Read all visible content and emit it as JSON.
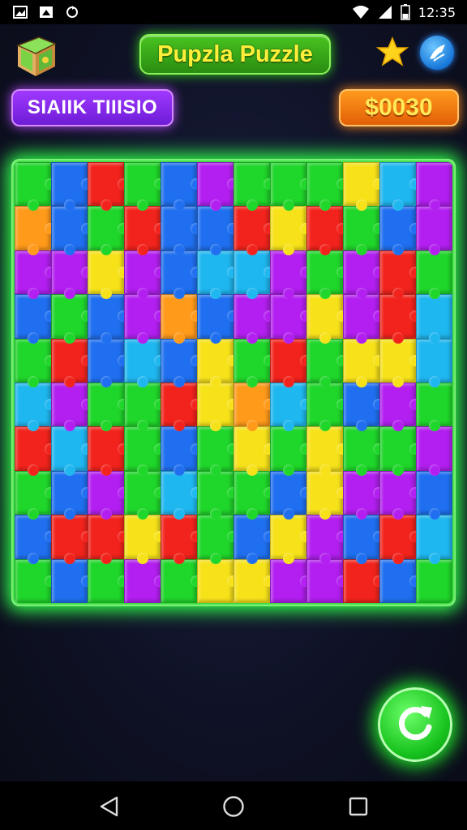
{
  "status_bar": {
    "time": "12:35"
  },
  "header": {
    "title": "Pupzla Puzzle",
    "level_label": "SIAIIK TIIISIO",
    "coins": "$0030"
  },
  "colors": {
    "board_glow": "#2fff4a",
    "title_green": "#2a8d12",
    "level_purple": "#7d22e6",
    "coin_orange": "#f06b0a"
  },
  "icons": [
    "chest-icon",
    "star-icon",
    "share-icon",
    "rotate-icon",
    "back-icon",
    "home-icon",
    "recents-icon"
  ],
  "board": {
    "cols": 12,
    "rows": 10,
    "palette": {
      "G": "#1fd62a",
      "B": "#1f6ff0",
      "R": "#f2231c",
      "Y": "#f7e21a",
      "P": "#b21ff0",
      "C": "#1fb7f0",
      "O": "#ff9a1a"
    },
    "pieces": [
      "GBRGBPGGGYCP",
      "OBGRBBRYRGBP",
      "PPYPBCCPGPRG",
      "BGBPOBPPYPRC",
      "GRBCBYGRGYYC",
      "CPGGRYOCGBPG",
      "RCRGBGYGYGGP",
      "GBPGCGGBYPPB",
      "BRRYRGBYPBRC",
      "GBGPGYYPPRBG"
    ]
  }
}
